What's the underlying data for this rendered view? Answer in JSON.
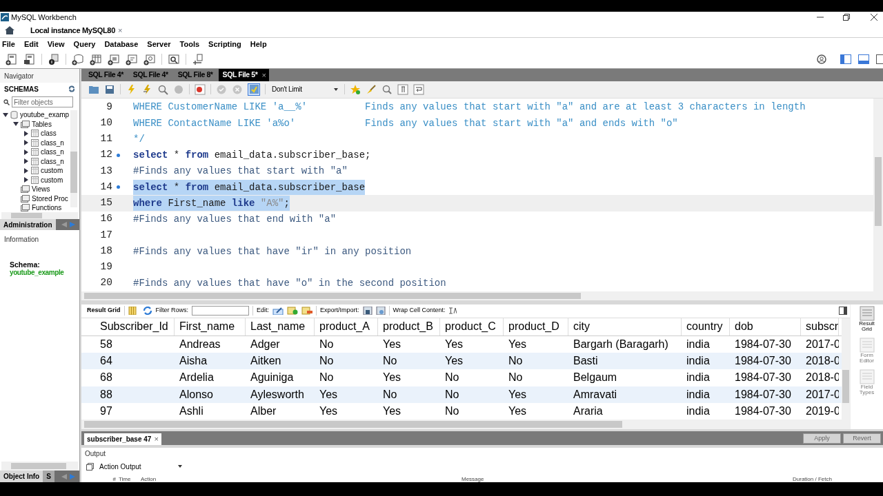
{
  "window": {
    "title": "MySQL Workbench"
  },
  "connection_tab": {
    "label": "Local instance MySQL80",
    "close": "×"
  },
  "menu": [
    "File",
    "Edit",
    "View",
    "Query",
    "Database",
    "Server",
    "Tools",
    "Scripting",
    "Help"
  ],
  "navigator": {
    "title": "Navigator",
    "section": "SCHEMAS",
    "filter_placeholder": "Filter objects",
    "tree": [
      {
        "label": "youtube_examp",
        "kind": "schema",
        "expanded": true,
        "children": [
          {
            "label": "Tables",
            "kind": "folder",
            "expanded": true,
            "children": [
              {
                "label": "class",
                "kind": "table",
                "expanded": false
              },
              {
                "label": "class_n",
                "kind": "table",
                "expanded": false
              },
              {
                "label": "class_n",
                "kind": "table",
                "expanded": false
              },
              {
                "label": "class_n",
                "kind": "table",
                "expanded": false
              },
              {
                "label": "custom",
                "kind": "table",
                "expanded": false
              },
              {
                "label": "custom",
                "kind": "table",
                "expanded": false
              }
            ]
          },
          {
            "label": "Views",
            "kind": "folder"
          },
          {
            "label": "Stored Proc",
            "kind": "folder"
          },
          {
            "label": "Functions",
            "kind": "folder"
          }
        ]
      }
    ]
  },
  "admin_tabs": [
    {
      "label": "Administration",
      "selected": true
    }
  ],
  "information": {
    "title": "Information",
    "schema_label": "Schema:",
    "schema_value": "youtube_example"
  },
  "bottom_tabs": [
    {
      "label": "Object Info",
      "selected": true
    },
    {
      "label": "S",
      "selected": false
    }
  ],
  "sql_tabs": [
    {
      "label": "SQL File 4*",
      "selected": false
    },
    {
      "label": "SQL File 4*",
      "selected": false
    },
    {
      "label": "SQL File 8*",
      "selected": false
    },
    {
      "label": "SQL File 5*",
      "selected": true,
      "close": "×"
    }
  ],
  "limit": {
    "value": "Don't Limit"
  },
  "autocommit": {
    "on": true
  },
  "editor_lines": [
    {
      "number": "9",
      "marker": false,
      "selected": false,
      "current": false,
      "tokens": [
        {
          "text": "WHERE CustomerName LIKE 'a__%'          Finds any values that start with \"a\" and are at least 3 characters in length",
          "kind": "block_comment"
        }
      ]
    },
    {
      "number": "10",
      "marker": false,
      "selected": false,
      "current": false,
      "tokens": [
        {
          "text": "WHERE ContactName LIKE 'a%o'            Finds any values that start with \"a\" and ends with \"o\"",
          "kind": "block_comment"
        }
      ]
    },
    {
      "number": "11",
      "marker": false,
      "selected": false,
      "current": false,
      "tokens": [
        {
          "text": "*/",
          "kind": "block_comment"
        }
      ]
    },
    {
      "number": "12",
      "marker": true,
      "selected": false,
      "current": false,
      "tokens": [
        {
          "text": "select",
          "kind": "keyword"
        },
        {
          "text": " * ",
          "kind": "plain"
        },
        {
          "text": "from",
          "kind": "keyword"
        },
        {
          "text": " email_data.subscriber_base;",
          "kind": "plain"
        }
      ]
    },
    {
      "number": "13",
      "marker": false,
      "selected": false,
      "current": false,
      "tokens": [
        {
          "text": "#Finds any values that start with \"a\"",
          "kind": "comment"
        }
      ]
    },
    {
      "number": "14",
      "marker": true,
      "selected": true,
      "current": false,
      "tokens": [
        {
          "text": "select",
          "kind": "keyword"
        },
        {
          "text": " * ",
          "kind": "plain"
        },
        {
          "text": "from",
          "kind": "keyword"
        },
        {
          "text": " email_data.subscriber_base",
          "kind": "plain"
        }
      ]
    },
    {
      "number": "15",
      "marker": false,
      "selected": true,
      "current": true,
      "tokens": [
        {
          "text": "where",
          "kind": "keyword"
        },
        {
          "text": " First_name ",
          "kind": "plain"
        },
        {
          "text": "like",
          "kind": "keyword"
        },
        {
          "text": " \"A%\"",
          "kind": "string"
        },
        {
          "text": ";",
          "kind": "plain"
        }
      ]
    },
    {
      "number": "16",
      "marker": false,
      "selected": false,
      "current": false,
      "tokens": [
        {
          "text": "#Finds any values that end with \"a\"",
          "kind": "comment"
        }
      ]
    },
    {
      "number": "17",
      "marker": false,
      "selected": false,
      "current": false
    },
    {
      "number": "18",
      "marker": false,
      "selected": false,
      "current": false,
      "tokens": [
        {
          "text": "#Finds any values that have \"ir\" in any position",
          "kind": "comment"
        }
      ]
    },
    {
      "number": "19",
      "marker": false,
      "selected": false,
      "current": false
    },
    {
      "number": "20",
      "marker": false,
      "selected": false,
      "current": false,
      "tokens": [
        {
          "text": "#Finds any values that have \"o\" in the second position",
          "kind": "comment"
        }
      ]
    }
  ],
  "result_toolbar": {
    "result_grid": "Result Grid",
    "filter_label": "Filter Rows:",
    "edit_label": "Edit:",
    "export_label": "Export/Import:",
    "wrap_label": "Wrap Cell Content:"
  },
  "table": {
    "columns": [
      "Subscriber_Id",
      "First_name",
      "Last_name",
      "product_A",
      "product_B",
      "product_C",
      "product_D",
      "city",
      "country",
      "dob",
      "subscr"
    ],
    "rows": [
      [
        "58",
        "Andreas",
        "Adger",
        "No",
        "Yes",
        "Yes",
        "Yes",
        "Bargarh (Baragarh)",
        "india",
        "1984-07-30",
        "2017-0"
      ],
      [
        "64",
        "Aisha",
        "Aitken",
        "No",
        "No",
        "Yes",
        "No",
        "Basti",
        "india",
        "1984-07-30",
        "2018-0"
      ],
      [
        "68",
        "Ardelia",
        "Aguiniga",
        "No",
        "Yes",
        "No",
        "No",
        "Belgaum",
        "india",
        "1984-07-30",
        "2018-0"
      ],
      [
        "88",
        "Alonso",
        "Aylesworth",
        "Yes",
        "No",
        "No",
        "Yes",
        "Amravati",
        "india",
        "1984-07-30",
        "2017-0"
      ],
      [
        "97",
        "Ashli",
        "Alber",
        "Yes",
        "Yes",
        "No",
        "Yes",
        "Araria",
        "india",
        "1984-07-30",
        "2019-0"
      ]
    ]
  },
  "side_views": [
    {
      "label": "Result Grid",
      "selected": true
    },
    {
      "label": "Form Editor",
      "selected": false
    },
    {
      "label": "Field Types",
      "selected": false
    }
  ],
  "result_tabs": [
    {
      "label": "subscriber_base 47",
      "selected": true,
      "close": "×"
    }
  ],
  "result_buttons": [
    {
      "label": "Apply",
      "disabled": true
    },
    {
      "label": "Revert",
      "disabled": true
    }
  ],
  "output": {
    "title": "Output",
    "selector": "Action Output",
    "columns": [
      "#",
      "Time",
      "Action",
      "Message",
      "Duration / Fetch"
    ]
  }
}
